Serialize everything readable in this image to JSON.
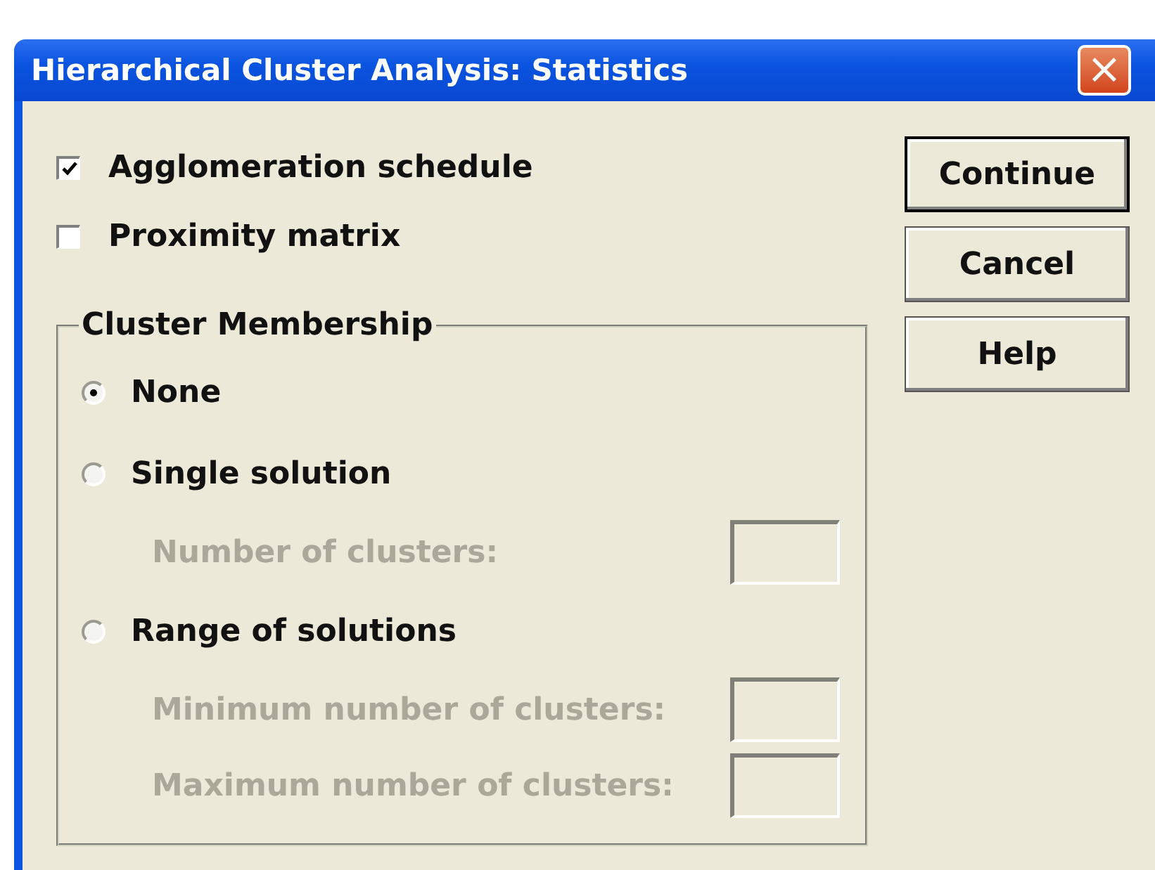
{
  "window": {
    "title": "Hierarchical Cluster Analysis: Statistics",
    "close": "×"
  },
  "checkboxes": [
    {
      "label": "Agglomeration schedule",
      "checked": true
    },
    {
      "label": "Proximity matrix",
      "checked": false
    }
  ],
  "cluster_membership": {
    "title": "Cluster Membership",
    "options": [
      {
        "label": "None",
        "selected": true
      },
      {
        "label": "Single solution",
        "selected": false,
        "fields": [
          {
            "label": "Number of clusters:",
            "disabled": true
          }
        ]
      },
      {
        "label": "Range of solutions",
        "selected": false,
        "fields": [
          {
            "label": "Minimum number of clusters:",
            "disabled": true
          },
          {
            "label": "Maximum number of clusters:",
            "disabled": true
          }
        ]
      }
    ]
  },
  "buttons": [
    {
      "label": "Continue",
      "default": true
    },
    {
      "label": "Cancel",
      "default": false
    },
    {
      "label": "Help",
      "default": false
    }
  ]
}
